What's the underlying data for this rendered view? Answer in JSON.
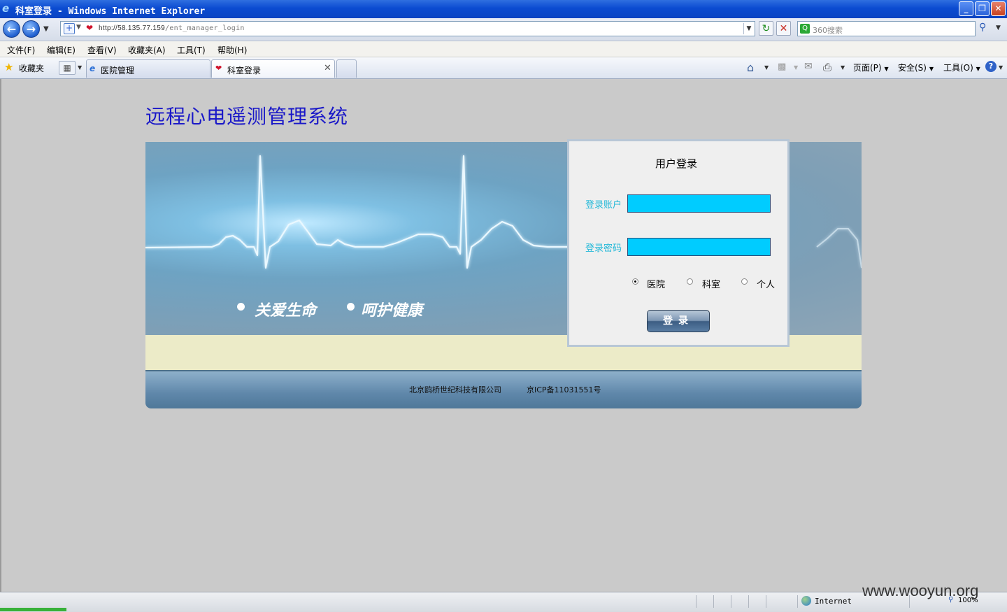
{
  "window": {
    "title": "科室登录 - Windows Internet Explorer",
    "minimize": "_",
    "restore": "❐",
    "close": "✕"
  },
  "address_bar": {
    "url_host": "http://58.135.77.159",
    "url_path": "/ent_manager_login",
    "search_placeholder": "360搜索"
  },
  "menu": [
    "文件(F)",
    "编辑(E)",
    "查看(V)",
    "收藏夹(A)",
    "工具(T)",
    "帮助(H)"
  ],
  "favorites_label": "收藏夹",
  "tabs": [
    {
      "label": "医院管理",
      "active": false
    },
    {
      "label": "科室登录",
      "active": true
    }
  ],
  "command_bar": {
    "page": "页面(P)",
    "safety": "安全(S)",
    "tools": "工具(O)"
  },
  "page": {
    "system_title": "远程心电遥测管理系统",
    "slogans": [
      "关爱生命",
      "呵护健康"
    ],
    "login": {
      "title": "用户登录",
      "account_label": "登录账户",
      "password_label": "登录密码",
      "account_value": "",
      "password_value": "",
      "options": [
        "医院",
        "科室",
        "个人"
      ],
      "selected_option": "医院",
      "submit_label": "登录"
    },
    "footer": {
      "company": "北京鸥桥世纪科技有限公司",
      "icp": "京ICP备11031551号"
    }
  },
  "status_bar": {
    "zone": "Internet",
    "zoom": "100%"
  },
  "watermark": "www.wooyun.org"
}
